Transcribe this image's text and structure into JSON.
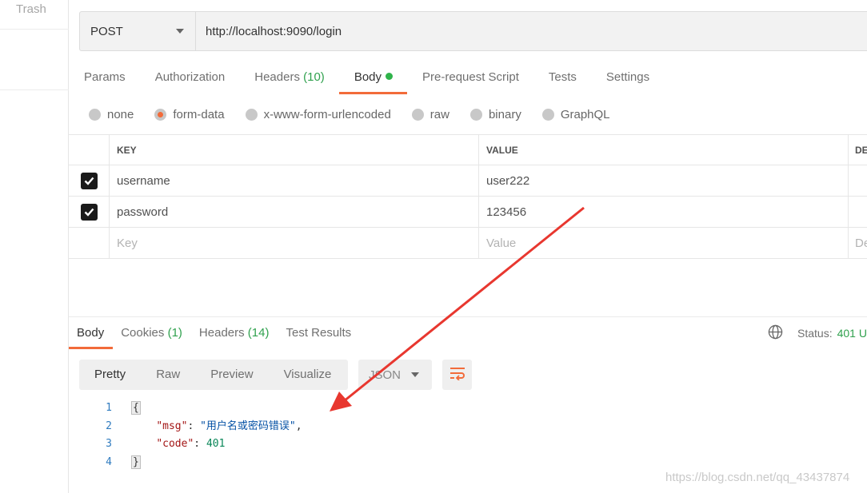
{
  "sidebar": {
    "trash_label": "Trash"
  },
  "request": {
    "method": "POST",
    "url": "http://localhost:9090/login",
    "tabs": [
      {
        "label": "Params",
        "count": ""
      },
      {
        "label": "Authorization",
        "count": ""
      },
      {
        "label": "Headers",
        "count": "(10)"
      },
      {
        "label": "Body",
        "count": ""
      },
      {
        "label": "Pre-request Script",
        "count": ""
      },
      {
        "label": "Tests",
        "count": ""
      },
      {
        "label": "Settings",
        "count": ""
      }
    ],
    "active_tab": "Body",
    "body_types": [
      "none",
      "form-data",
      "x-www-form-urlencoded",
      "raw",
      "binary",
      "GraphQL"
    ],
    "selected_body_type": "form-data"
  },
  "params_table": {
    "headers": {
      "key": "KEY",
      "value": "VALUE",
      "description": "DE"
    },
    "rows": [
      {
        "checked": true,
        "key": "username",
        "value": "user222"
      },
      {
        "checked": true,
        "key": "password",
        "value": "123456"
      }
    ],
    "placeholders": {
      "key": "Key",
      "value": "Value",
      "description": "De"
    }
  },
  "response": {
    "tabs": [
      {
        "label": "Body",
        "count": ""
      },
      {
        "label": "Cookies",
        "count": "(1)"
      },
      {
        "label": "Headers",
        "count": "(14)"
      },
      {
        "label": "Test Results",
        "count": ""
      }
    ],
    "active_tab": "Body",
    "status_label": "Status:",
    "status_value": "401 U",
    "view_modes": [
      "Pretty",
      "Raw",
      "Preview",
      "Visualize"
    ],
    "active_view": "Pretty",
    "format": "JSON",
    "code_lines": [
      {
        "num": "1",
        "text": "{"
      },
      {
        "num": "2",
        "key": "\"msg\"",
        "sep": ": ",
        "value": "\"用户名或密码错误\"",
        "tail": ","
      },
      {
        "num": "3",
        "key": "\"code\"",
        "sep": ": ",
        "value": "401",
        "tail": ""
      },
      {
        "num": "4",
        "text": "}"
      }
    ]
  },
  "watermark": "https://blog.csdn.net/qq_43437874",
  "colors": {
    "accent": "#f26b3a",
    "success": "#30a14e",
    "annotation_arrow": "#e8372f"
  }
}
